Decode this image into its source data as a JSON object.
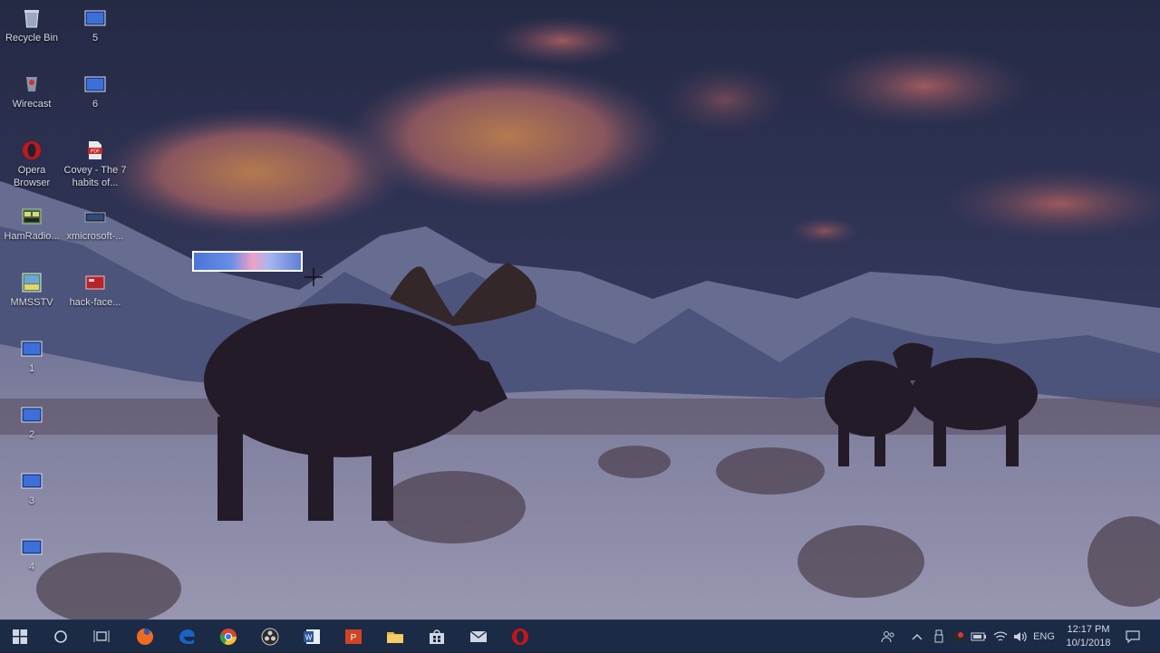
{
  "desktop": {
    "icons": [
      {
        "label": "Recycle Bin",
        "icon": "recycle-bin-icon"
      },
      {
        "label": "5",
        "icon": "screenshot-file-icon"
      },
      {
        "label": "Wirecast",
        "icon": "wirecast-icon"
      },
      {
        "label": "6",
        "icon": "screenshot-file-icon"
      },
      {
        "label": "Opera Browser",
        "icon": "opera-icon"
      },
      {
        "label": "Covey - The 7 habits of...",
        "icon": "pdf-file-icon"
      },
      {
        "label": "HamRadio...",
        "icon": "hamradio-icon"
      },
      {
        "label": "xmicrosoft-...",
        "icon": "screenshot-file-icon"
      },
      {
        "label": "MMSSTV",
        "icon": "mmsstv-icon"
      },
      {
        "label": "hack-face...",
        "icon": "image-file-icon"
      },
      {
        "label": "1",
        "icon": "screenshot-file-icon"
      },
      {
        "label": "2",
        "icon": "screenshot-file-icon"
      },
      {
        "label": "3",
        "icon": "screenshot-file-icon"
      },
      {
        "label": "4",
        "icon": "screenshot-file-icon"
      }
    ]
  },
  "taskbar": {
    "pinned": [
      "start-button",
      "search-button",
      "task-view-button",
      "firefox",
      "edge",
      "chrome",
      "obs-studio",
      "word",
      "powerpoint",
      "file-explorer",
      "store",
      "mail",
      "opera"
    ],
    "tray": {
      "language": "ENG",
      "time": "12:17 PM",
      "date": "10/1/2018"
    }
  },
  "colors": {
    "taskbar_bg": "#1b2a45",
    "selection_border": "#ffffff"
  }
}
